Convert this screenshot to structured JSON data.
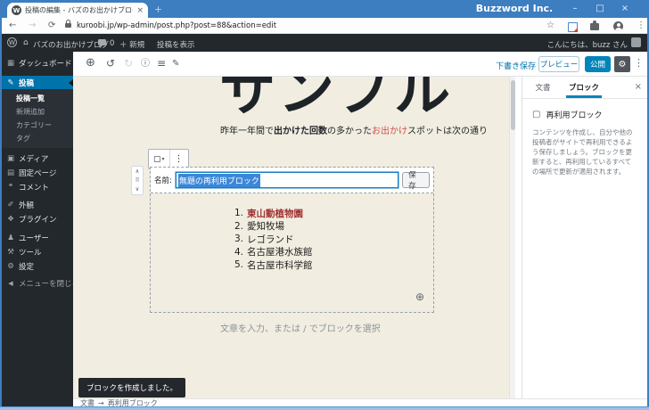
{
  "browser": {
    "window_title": "Buzzword Inc.",
    "tab_title": "投稿の編集 - バズのお出かけブログ -",
    "url": "kuroobi.jp/wp-admin/post.php?post=88&action=edit"
  },
  "admin_bar": {
    "site_name": "バズのお出かけブログ",
    "comment_count": "0",
    "new_label": "＋ 新規",
    "view_post": "投稿を表示",
    "greeting": "こんにちは、buzz さん"
  },
  "sidebar": {
    "items": [
      {
        "label": "ダッシュボード"
      },
      {
        "label": "投稿"
      },
      {
        "label": "メディア"
      },
      {
        "label": "固定ページ"
      },
      {
        "label": "コメント"
      },
      {
        "label": "外観"
      },
      {
        "label": "プラグイン"
      },
      {
        "label": "ユーザー"
      },
      {
        "label": "ツール"
      },
      {
        "label": "設定"
      },
      {
        "label": "メニューを閉じる"
      }
    ],
    "posts_submenu": [
      {
        "label": "投稿一覧"
      },
      {
        "label": "新規追加"
      },
      {
        "label": "カテゴリー"
      },
      {
        "label": "タグ"
      }
    ]
  },
  "editor_header": {
    "save_draft": "下書き保存",
    "preview": "プレビュー",
    "publish": "公開"
  },
  "content": {
    "post_title": "サンプル",
    "paragraph": {
      "t1": "昨年一年間で",
      "bold": "出かけた回数",
      "t2": "の多かった",
      "red": "お出かけ",
      "t3": "スポットは次の通り"
    },
    "reusable_block": {
      "name_label": "名前:",
      "name_value": "無題の再利用ブロック",
      "save_button": "保存"
    },
    "list": {
      "numbers": [
        "1.",
        "2.",
        "3.",
        "4.",
        "5."
      ],
      "items": [
        "東山動植物園",
        "愛知牧場",
        "レゴランド",
        "名古屋港水族館",
        "名古屋市科学館"
      ]
    },
    "placeholder": "文章を入力、または / でブロックを選択"
  },
  "right_panel": {
    "tab_document": "文書",
    "tab_block": "ブロック",
    "block_title": "再利用ブロック",
    "block_description": "コンテンツを作成し、自分や他の投稿者がサイトで再利用できるよう保存しましょう。ブロックを更新すると、再利用しているすべての場所で更新が適用されます。"
  },
  "toast": "ブロックを作成しました。",
  "footer": {
    "document": "文書",
    "arrow": "→",
    "block": "再利用ブロック"
  },
  "icons": {
    "wp_logo": "W",
    "home": "⌂",
    "back": "←",
    "forward": "→",
    "reload": "⟳",
    "star": "☆",
    "menu_dots": "⋮",
    "minimize": "–",
    "maximize": "□",
    "close": "×",
    "tab_close": "×",
    "new_tab": "＋",
    "dashboard": "▦",
    "posts": "✎",
    "media": "▣",
    "pages": "▤",
    "comments": "❝",
    "appearance": "✐",
    "plugins": "❖",
    "users": "♟",
    "tools": "⚒",
    "settings": "⚙",
    "collapse": "◀",
    "add_block": "⊕",
    "undo": "↺",
    "redo": "↻",
    "info": "ⓘ",
    "list_view": "≡",
    "edit": "✎",
    "gear": "⚙",
    "block_box": "▢",
    "caret_down": "▾",
    "mover_up": "∧",
    "mover_handle": "⠿",
    "mover_down": "∨",
    "appender_plus": "⊕"
  },
  "colors": {
    "titlebar": "#3c7ebf",
    "admin_dark": "#23282d",
    "menu_active_blue": "#0073aa",
    "publish_blue": "#0085ba",
    "canvas_beige": "#f1ede0",
    "red_text": "#d14f4f",
    "list_maroon": "#a03333",
    "selection_blue": "#3a87d8"
  }
}
